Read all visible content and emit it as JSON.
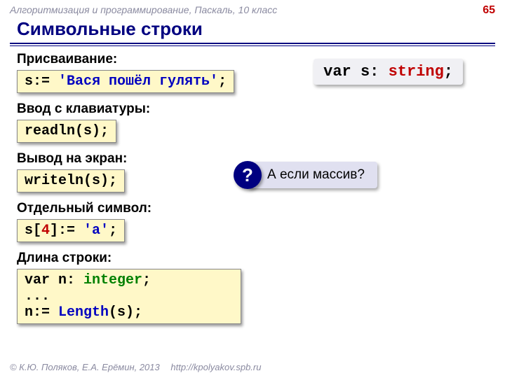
{
  "header": {
    "course": "Алгоритмизация и программирование, Паскаль, 10 класс",
    "page": "65"
  },
  "title": "Символьные строки",
  "varDecl": {
    "kw": "var",
    "name": " s: ",
    "type": "string",
    "tail": ";"
  },
  "sections": {
    "assign": {
      "label": "Присваивание:",
      "c1": "s:= ",
      "c2": "'Вася пошёл гулять'",
      "c3": ";"
    },
    "input": {
      "label": "Ввод с клавиатуры:",
      "c1": "readln(s);"
    },
    "output": {
      "label": "Вывод на экран:",
      "c1": "writeln(s);"
    },
    "char": {
      "label": "Отдельный символ:",
      "c1": "s[",
      "c2": "4",
      "c3": "]:= ",
      "c4": "'а'",
      "c5": ";"
    },
    "length": {
      "label": "Длина строки:",
      "l1a": "var",
      "l1b": " n: ",
      "l1c": "integer",
      "l1d": ";",
      "l2": "...",
      "l3a": "n:= ",
      "l3b": "Length",
      "l3c": "(s);"
    }
  },
  "question": {
    "mark": "?",
    "text": "А если массив?"
  },
  "footer": {
    "copyright": "© К.Ю. Поляков, Е.А. Ерёмин, 2013",
    "url": "http://kpolyakov.spb.ru"
  }
}
